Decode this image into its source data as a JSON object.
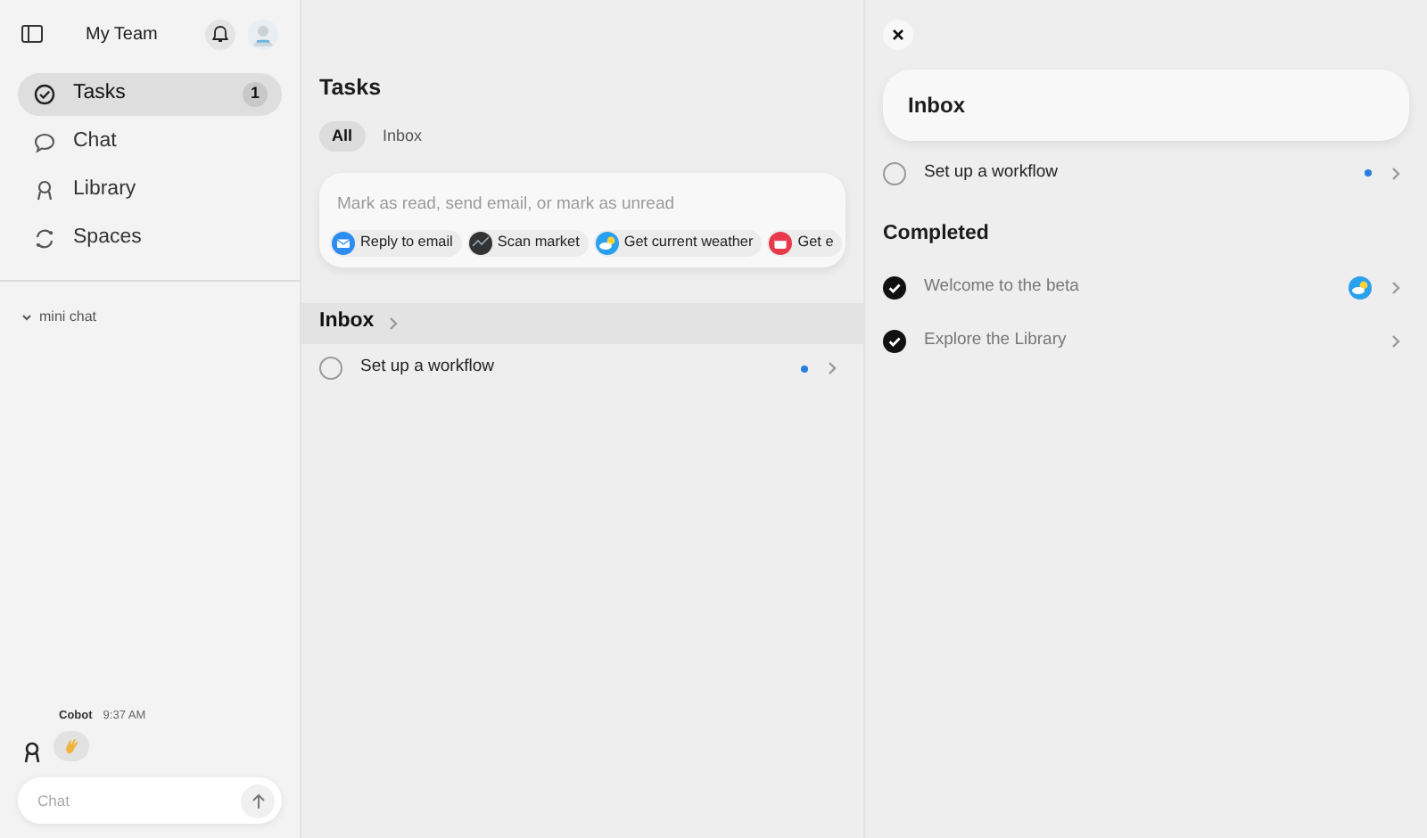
{
  "sidebar": {
    "title": "My Team",
    "nav": [
      {
        "label": "Tasks",
        "kind": "check",
        "selected": true,
        "badge": "1"
      },
      {
        "label": "Chat",
        "kind": "chat",
        "selected": false
      },
      {
        "label": "Library",
        "kind": "library",
        "selected": false
      },
      {
        "label": "Spaces",
        "kind": "spaces",
        "selected": false
      }
    ],
    "section": {
      "label": "mini chat",
      "expanded": true
    },
    "chat": {
      "sender": "Cobot",
      "time": "9:37 AM",
      "placeholder": "Chat"
    }
  },
  "main": {
    "title": "Tasks",
    "filters": [
      {
        "label": "All",
        "selected": true
      },
      {
        "label": "Inbox",
        "selected": false
      }
    ],
    "composer": {
      "placeholder": "Mark as read, send email, or mark as unread",
      "suggestions": [
        {
          "label": "Reply to email",
          "kind": "mail"
        },
        {
          "label": "Scan market",
          "kind": "market"
        },
        {
          "label": "Get current weather",
          "kind": "weather"
        },
        {
          "label": "Get e",
          "kind": "calendar"
        }
      ]
    },
    "group": {
      "title": "Inbox",
      "tasks": [
        {
          "label": "Set up a workflow",
          "done": false,
          "unread": true
        }
      ]
    }
  },
  "detail": {
    "title": "Inbox",
    "tasks": [
      {
        "label": "Set up a workflow",
        "done": false,
        "unread": true
      }
    ],
    "completed_title": "Completed",
    "completed": [
      {
        "label": "Welcome to the beta",
        "done": true,
        "unread": false,
        "kind": "weather"
      },
      {
        "label": "Explore the Library",
        "done": true,
        "unread": false,
        "kind": "plain"
      }
    ]
  }
}
